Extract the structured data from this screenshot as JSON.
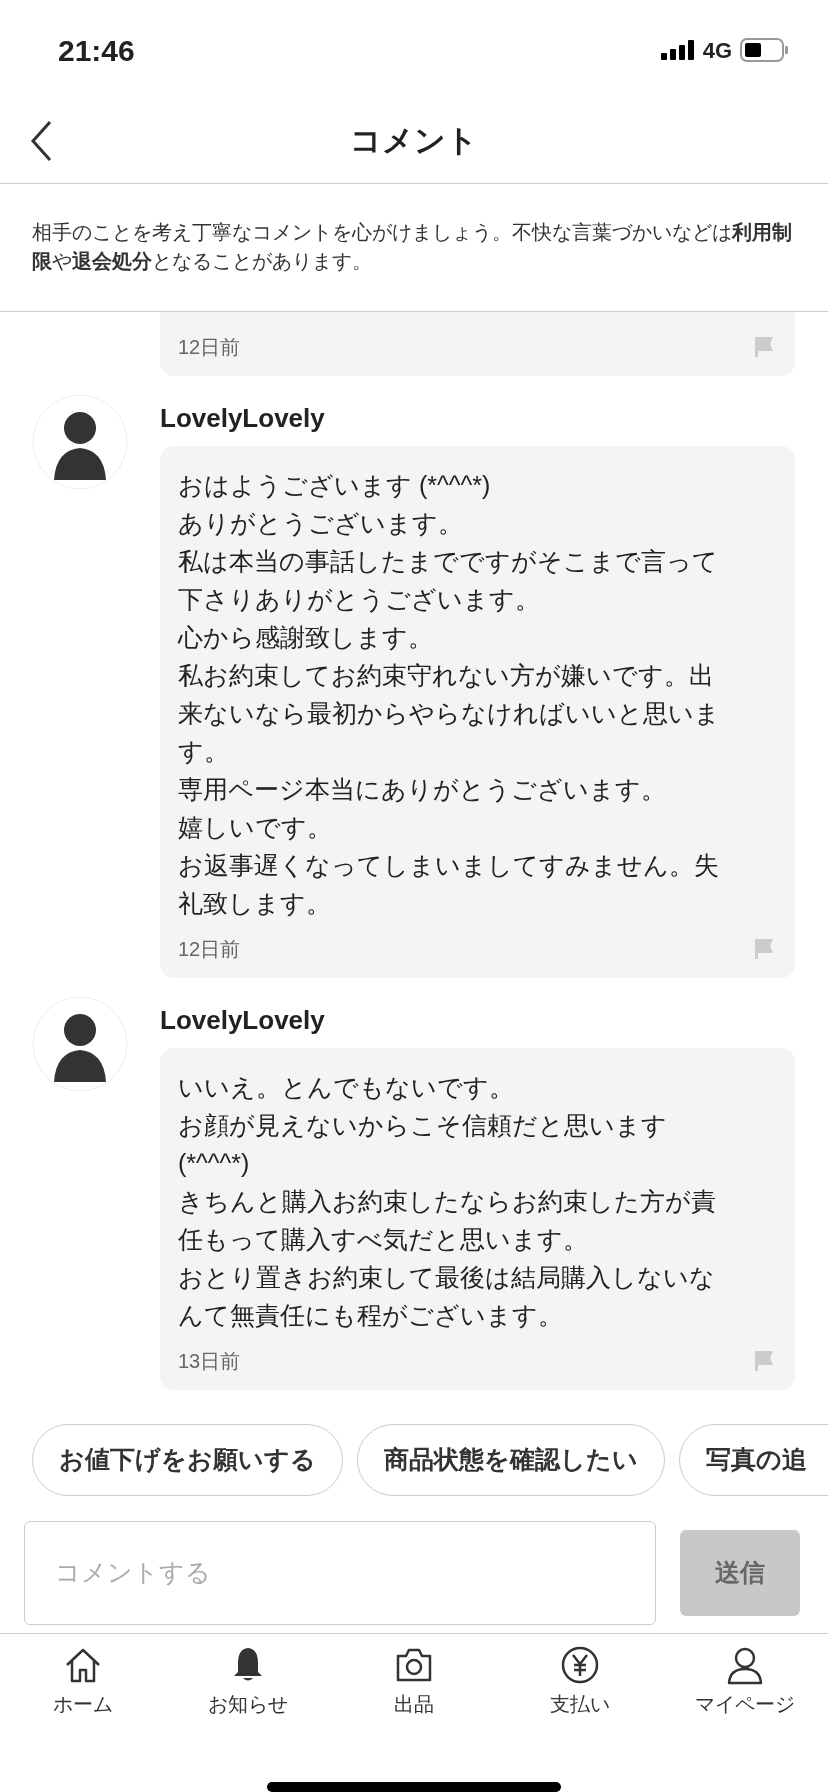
{
  "status_bar": {
    "time": "21:46",
    "network": "4G"
  },
  "header": {
    "title": "コメント"
  },
  "notice": "相手のことを考え丁寧なコメントを心がけましょう。不快な言葉づかいなどは**利用制限**や**退会処分**となることがあります。",
  "comments": [
    {
      "kind": "partial",
      "time": "12日前"
    },
    {
      "kind": "full",
      "user": "LovelyLovely",
      "paragraphs": [
        "おはようございます (*^^^*)",
        "ありがとうございます。",
        "私は本当の事話したまでですがそこまで言って下さりありがとうございます。",
        "心から感謝致します。",
        "私お約束してお約束守れない方が嫌いです。出来ないなら最初からやらなければいいと思います。",
        "専用ページ本当にありがとうございます。",
        "嬉しいです。",
        "お返事遅くなってしまいましてすみません。失礼致します。"
      ],
      "time": "12日前"
    },
    {
      "kind": "full",
      "user": "LovelyLovely",
      "paragraphs": [
        "いいえ。とんでもないです。",
        "お顔が見えないからこそ信頼だと思います(*^^^*)",
        "きちんと購入お約束したならお約束した方が責任もって購入すべ気だと思います。",
        "おとり置きお約束して最後は結局購入しないなんて無責任にも程がございます。"
      ],
      "time": "13日前"
    }
  ],
  "quick_replies": [
    "お値下げをお願いする",
    "商品状態を確認したい",
    "写真の追"
  ],
  "comment_input": {
    "placeholder": "コメントする"
  },
  "send_button": {
    "label": "送信",
    "disabled": true
  },
  "tab_bar": [
    {
      "kind": "home",
      "label": "ホーム"
    },
    {
      "kind": "bell",
      "label": "お知らせ"
    },
    {
      "kind": "camera",
      "label": "出品"
    },
    {
      "kind": "yen",
      "label": "支払い"
    },
    {
      "kind": "person",
      "label": "マイページ"
    }
  ]
}
